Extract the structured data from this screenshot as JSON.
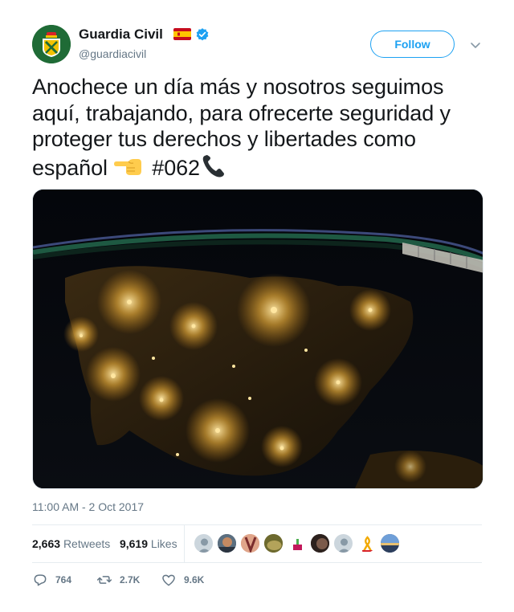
{
  "author": {
    "name": "Guardia Civil",
    "handle": "@guardiacivil",
    "verified": true,
    "flag_icon": "spain-flag-icon",
    "avatar_icon": "guardia-civil-emblem-icon"
  },
  "follow_label": "Follow",
  "tweet": {
    "text_main": "Anochece un día más y nosotros seguimos aquí, trabajando, para ofrecerte seguridad y proteger tus derechos y libertades como español",
    "emoji_pointing": "backhand-index-pointing-left-icon",
    "hashtag": "#062",
    "emoji_phone": "telephone-receiver-icon"
  },
  "media": {
    "type": "photo",
    "description_icon": "night-satellite-photo-icon"
  },
  "timestamp": "11:00 AM - 2 Oct 2017",
  "stats": {
    "retweets_count": "2,663",
    "retweets_label": "Retweets",
    "likes_count": "9,619",
    "likes_label": "Likes"
  },
  "likers_count_shown": 9,
  "actions": {
    "reply_count": "764",
    "retweet_count": "2.7K",
    "like_count": "9.6K"
  },
  "colors": {
    "accent": "#1da1f2",
    "text": "#14171a",
    "muted": "#657786",
    "divider": "#e6ecf0"
  }
}
